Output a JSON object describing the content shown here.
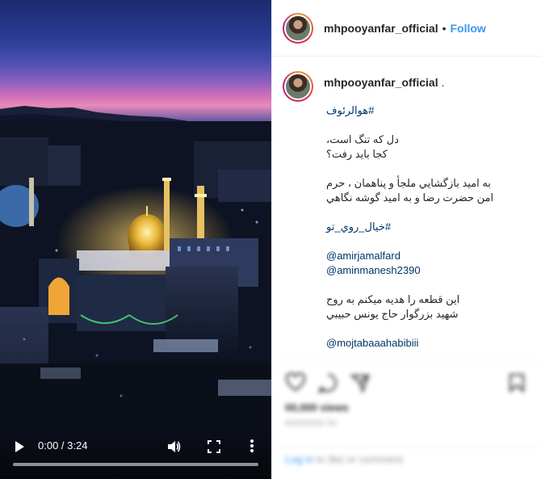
{
  "video": {
    "time_current": "0:00",
    "time_total": "3:24",
    "time_separator": " / ",
    "progress": 0
  },
  "header": {
    "username": "mhpooyanfar_official",
    "dot": "•",
    "follow_label": "Follow"
  },
  "caption": {
    "username": "mhpooyanfar_official",
    "username_suffix": " .",
    "lines": [
      {
        "text": "#هوالرئوف",
        "type": "link"
      },
      {
        "text": "",
        "type": "gap"
      },
      {
        "text": "دل که تنگ است،",
        "type": "text"
      },
      {
        "text": "كجا بايد رفت؟",
        "type": "text"
      },
      {
        "text": "",
        "type": "gap"
      },
      {
        "text": "به اميد بازگشايي ملجأ و پناهمان ، حرم",
        "type": "text"
      },
      {
        "text": "امن حضرت رضا و به اميد گوشه نگاهي",
        "type": "text"
      },
      {
        "text": "",
        "type": "gap"
      },
      {
        "text": "#خيال_روي_تو",
        "type": "link"
      },
      {
        "text": "",
        "type": "gap"
      },
      {
        "text": "@amirjamalfard",
        "type": "link"
      },
      {
        "text": "@aminmanesh2390",
        "type": "link"
      },
      {
        "text": "",
        "type": "gap"
      },
      {
        "text": "اين قطعه را هديه ميكنم به روح",
        "type": "text"
      },
      {
        "text": "شهيد بزرگوار حاج يونس حبيبي",
        "type": "text"
      },
      {
        "text": "",
        "type": "gap"
      },
      {
        "text": "@mojtabaaahabibiii",
        "type": "link"
      }
    ]
  },
  "actions": {
    "views": "00,000 views",
    "date": "00000000 00",
    "login_link": "Log in",
    "login_text": " to like or comment."
  },
  "colors": {
    "link": "#003569",
    "follow": "#3897f0",
    "text": "#262626",
    "border": "#efefef"
  },
  "icons": [
    "play-icon",
    "volume-icon",
    "fullscreen-icon",
    "more-vertical-icon",
    "heart-icon",
    "comment-icon",
    "share-icon",
    "bookmark-icon"
  ]
}
